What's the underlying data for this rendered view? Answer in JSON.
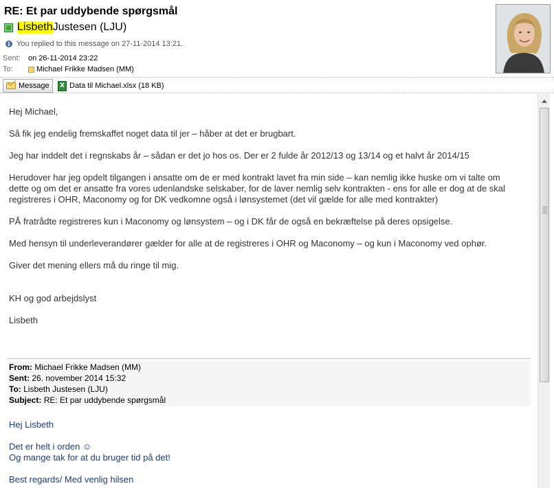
{
  "message": {
    "subject": "RE: Et par uddybende spørgsmål",
    "sender_first": "Lisbeth",
    "sender_rest": " Justesen (LJU)",
    "replied_notice": "You replied to this message on 27-11-2014 13:21.",
    "sent_label": "Sent:",
    "sent_value": "on 26-11-2014 23:22",
    "to_label": "To:",
    "to_value": "Michael Frikke Madsen (MM)"
  },
  "attachments": {
    "message_tab": "Message",
    "file": "Data til Michael.xlsx (18 KB)"
  },
  "body": {
    "greeting": "Hej Michael,",
    "p1": "Så fik jeg endelig fremskaffet noget data til jer – håber at det er brugbart.",
    "p2": "Jeg har inddelt det i regnskabs år – sådan  er det jo hos os. Der er 2 fulde år 2012/13 og 13/14 og et halvt år 2014/15",
    "p3_l1": "Herudover har jeg opdelt tilgangen i ansatte om de er med kontrakt lavet fra min side – kan nemlig ikke huske om vi talte om",
    "p3_l2": "dette og om det er ansatte fra vores udenlandske selskaber, for de laver nemlig selv kontrakten  - ens for alle er dog at de skal",
    "p3_l3": "registreres i OHR, Maconomy og for DK vedkomne også i lønsystemet  (det vil gælde for alle med kontrakter)",
    "p4": "PÅ fratrådte registreres kun i Maconomy og lønsystem – og i DK får de også en bekræftelse på deres opsigelse.",
    "p5": "Med hensyn til underleverandører gælder for alle at de registreres i OHR og Maconomy – og kun i Maconomy ved ophør.",
    "p6": "Giver det mening ellers må du ringe til mig.",
    "closing": "KH og god arbejdslyst",
    "signature": "Lisbeth"
  },
  "quoted": {
    "from_label": "From:",
    "from_value": "Michael Frikke Madsen (MM)",
    "sent_label": "Sent:",
    "sent_value": "26. november 2014 15:32",
    "to_label": "To:",
    "to_value": "Lisbeth Justesen (LJU)",
    "subject_label": "Subject:",
    "subject_value": "RE: Et par uddybende spørgsmål",
    "greeting": "Hej Lisbeth",
    "line1": "Det er helt i orden ☺",
    "line2": "Og mange tak for at du bruger tid på det!",
    "regards": "Best regards/ Med venlig hilsen"
  },
  "colors": {
    "highlight": "#ffff00",
    "presence": "#3fa13f",
    "quoted_text": "#1f3d7a"
  }
}
